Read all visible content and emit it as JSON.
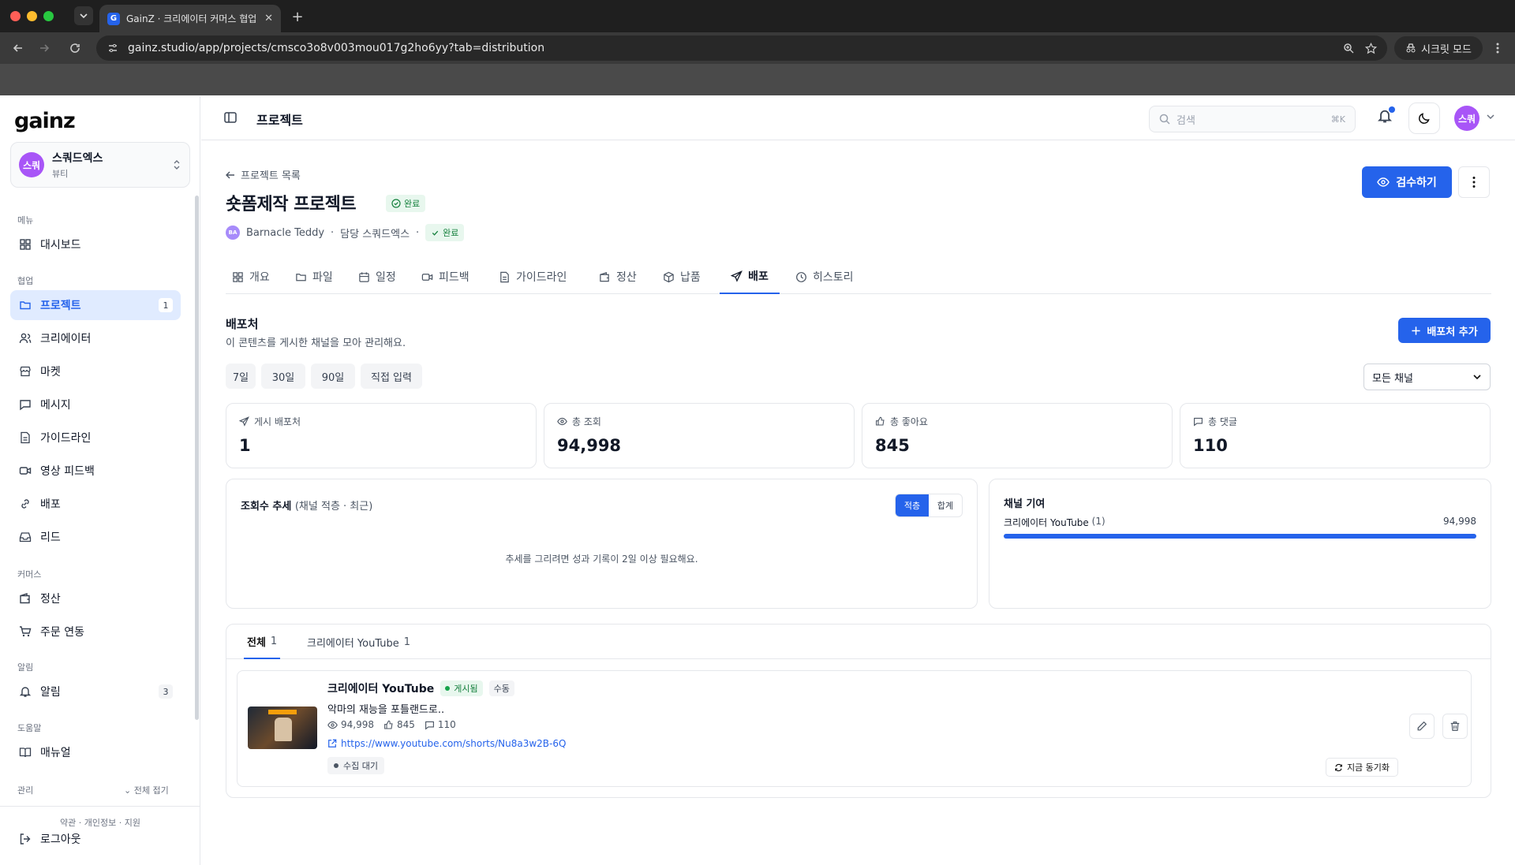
{
  "browser": {
    "tab_title": "GainZ · 크리에이터 커머스 협업 C",
    "favicon_letter": "G",
    "url": "gainz.studio/app/projects/cmsco3o8v003mou017g2ho6yy?tab=distribution",
    "incognito_label": "시크릿 모드"
  },
  "sidebar": {
    "logo": "gainz",
    "org": {
      "avatar": "스쿼",
      "name": "스쿼드엑스",
      "category": "뷰티"
    },
    "sections": {
      "menu": "메뉴",
      "collab": "협업",
      "commerce": "커머스",
      "alerts": "알림",
      "help": "도움말",
      "admin": "관리"
    },
    "items": {
      "dashboard": "대시보드",
      "projects": "프로젝트",
      "projects_count": "1",
      "creators": "크리에이터",
      "market": "마켓",
      "messages": "메시지",
      "guidelines": "가이드라인",
      "video_feedback": "영상 피드백",
      "distribution": "배포",
      "leads": "리드",
      "settlement": "정산",
      "order_sync": "주문 연동",
      "notifications": "알림",
      "notifications_count": "3",
      "manual": "매뉴얼",
      "logout": "로그아웃"
    },
    "fold_all": "전체 접기",
    "footer_links": "약관 · 개인정보 · 지원"
  },
  "topbar": {
    "title": "프로젝트",
    "search_placeholder": "검색",
    "search_shortcut": "⌘K",
    "user_avatar": "스쿼"
  },
  "project": {
    "back_label": "프로젝트 목록",
    "title": "숏폼제작 프로젝트",
    "status": "완료",
    "creator_avatar": "BA",
    "creator_name": "Barnacle Teddy",
    "manager": "담당 스쿼드엑스",
    "meta_status": "완료",
    "inspect_button": "검수하기"
  },
  "tabs": [
    "개요",
    "파일",
    "일정",
    "피드백",
    "가이드라인",
    "정산",
    "납품",
    "배포",
    "히스토리"
  ],
  "distribution": {
    "heading": "배포처",
    "description": "이 콘텐츠를 게시한 채널을 모아 관리해요.",
    "add_button": "배포처 추가",
    "ranges": [
      "7일",
      "30일",
      "90일",
      "직접 입력"
    ],
    "channel_filter": "모든 채널",
    "kpis": [
      {
        "label": "게시 배포처",
        "value": "1"
      },
      {
        "label": "총 조회",
        "value": "94,998"
      },
      {
        "label": "총 좋아요",
        "value": "845"
      },
      {
        "label": "총 댓글",
        "value": "110"
      }
    ],
    "trend": {
      "title": "조회수 추세",
      "subtitle": "(채널 적층 · 최근)",
      "mode_stacked": "적층",
      "mode_total": "합계",
      "empty_message": "추세를 그리려면 성과 기록이 2일 이상 필요해요."
    },
    "contribution": {
      "title": "채널 기여",
      "channel": "크리에이터 YouTube",
      "channel_count": "(1)",
      "value": "94,998",
      "share": 1.0
    },
    "list_tabs": [
      {
        "label": "전체",
        "count": "1"
      },
      {
        "label": "크리에이터 YouTube",
        "count": "1"
      }
    ],
    "row": {
      "channel": "크리에이터 YouTube",
      "status": "게시됨",
      "source": "수동",
      "title": "악마의 재능을 포틀랜드로..",
      "views": "94,998",
      "likes": "845",
      "comments": "110",
      "link": "https://www.youtube.com/shorts/Nu8a3w2B-6Q",
      "collect_status": "수집 대기",
      "sync_button": "지금 동기화"
    }
  },
  "colors": {
    "accent": "#2563eb",
    "success_bg": "#e8f7ee",
    "success_text": "#15803d",
    "avatar": "#a855f7"
  }
}
